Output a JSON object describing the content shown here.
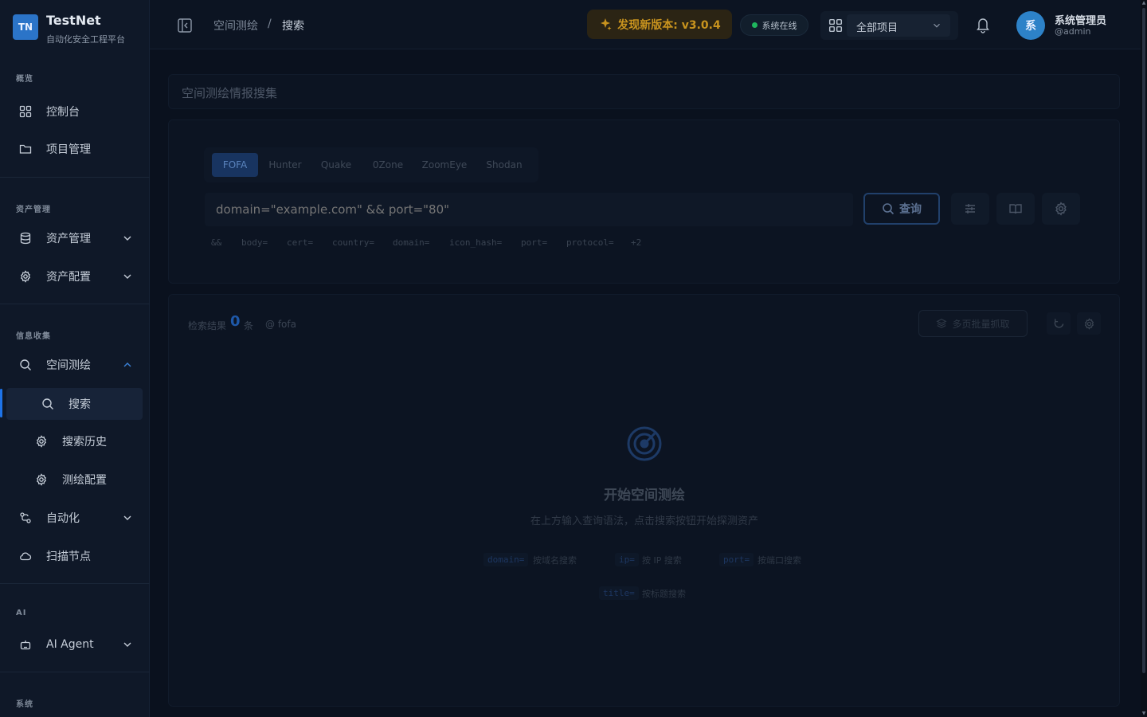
{
  "brand": {
    "logo": "TN",
    "title": "TestNet",
    "subtitle": "自动化安全工程平台"
  },
  "sidebar": {
    "sections": [
      {
        "label": "概览"
      },
      {
        "label": "资产管理"
      },
      {
        "label": "信息收集"
      },
      {
        "label": "AI"
      },
      {
        "label": "系统"
      }
    ],
    "items": [
      {
        "label": "控制台",
        "icon": "dashboard-icon"
      },
      {
        "label": "项目管理",
        "icon": "folder-icon"
      },
      {
        "label": "资产管理",
        "icon": "database-icon"
      },
      {
        "label": "资产配置",
        "icon": "gear-icon"
      },
      {
        "label": "空间测绘",
        "icon": "search-icon"
      },
      {
        "label": "搜索",
        "icon": "search-icon"
      },
      {
        "label": "搜索历史",
        "icon": "gear-icon"
      },
      {
        "label": "测绘配置",
        "icon": "gear-icon"
      },
      {
        "label": "自动化",
        "icon": "workflow-icon"
      },
      {
        "label": "扫描节点",
        "icon": "cloud-icon"
      },
      {
        "label": "AI Agent",
        "icon": "robot-icon"
      }
    ]
  },
  "header": {
    "breadcrumb": [
      "空间测绘",
      "/",
      "搜索"
    ],
    "new_version": "发现新版本: v3.0.4",
    "status": "系统在线",
    "project_select": "全部项目",
    "user": {
      "avatar": "系",
      "name": "系统管理员",
      "handle": "@admin"
    }
  },
  "search": {
    "title": "空间测绘情报搜集",
    "tabs": [
      "FOFA",
      "Hunter",
      "Quake",
      "0Zone",
      "ZoomEye",
      "Shodan"
    ],
    "active_tab": "FOFA",
    "placeholder": "domain=\"example.com\" && port=\"80\"",
    "query_button": "查询",
    "syntax_chips": [
      "&&",
      "body=",
      "cert=",
      "country=",
      "domain=",
      "icon_hash=",
      "port=",
      "protocol=",
      "+2"
    ]
  },
  "results": {
    "label": "检索结果",
    "count": "0",
    "unit": "条",
    "source": "@ fofa",
    "batch_button": "多页批量抓取"
  },
  "empty": {
    "title": "开始空间测绘",
    "description": "在上方输入查询语法，点击搜索按钮开始探测资产",
    "hints": [
      {
        "code": "domain=",
        "text": "按域名搜索"
      },
      {
        "code": "ip=",
        "text": "按 IP 搜索"
      },
      {
        "code": "port=",
        "text": "按端口搜索"
      },
      {
        "code": "title=",
        "text": "按标题搜索"
      }
    ]
  },
  "colors": {
    "accent": "#1e73e8",
    "warning": "#c8931e",
    "online": "#1fb65e"
  }
}
